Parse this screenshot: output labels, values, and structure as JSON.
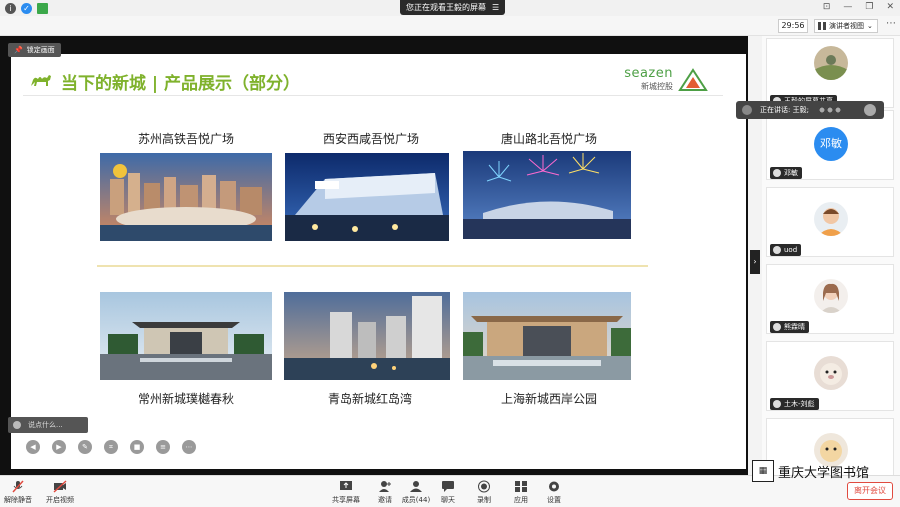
{
  "window": {
    "pill_text": "您正在观看王毅的屏幕",
    "timer": "29:56",
    "view_mode": "演讲者视图"
  },
  "stage": {
    "lock_label": "锁定画面",
    "chat_placeholder": "说点什么...",
    "slide": {
      "title": "当下的新城 | 产品展示（部分）",
      "brand_en": "seazen",
      "brand_cn": "新城控股",
      "cards": [
        {
          "caption": "苏州高铁吾悦广场"
        },
        {
          "caption": "西安西咸吾悦广场"
        },
        {
          "caption": "唐山路北吾悦广场"
        },
        {
          "caption": "常州新城璞樾春秋"
        },
        {
          "caption": "青岛新城红岛湾"
        },
        {
          "caption": "上海新城西岸公园"
        }
      ]
    }
  },
  "panel": {
    "speaking": "正在讲话: 王毅;",
    "participants": [
      {
        "name": "王毅的屏幕共享"
      },
      {
        "name": "邓敏",
        "initials": "邓敏"
      },
      {
        "name": "uod"
      },
      {
        "name": "熊霖晴"
      },
      {
        "name": "土木-刘彪"
      },
      {
        "name": ""
      }
    ],
    "watermark": "重庆大学图书馆"
  },
  "toolbar": {
    "mute": "解除静音",
    "video": "开启视频",
    "share": "共享屏幕",
    "invite": "邀请",
    "members": "成员(44)",
    "chat": "聊天",
    "record": "录制",
    "apps": "应用",
    "settings": "设置",
    "leave": "离开会议"
  },
  "colors": {
    "slide_title": "#7fb22c",
    "leave": "#e04a3f",
    "avatar_blue": "#2b8cf0"
  }
}
